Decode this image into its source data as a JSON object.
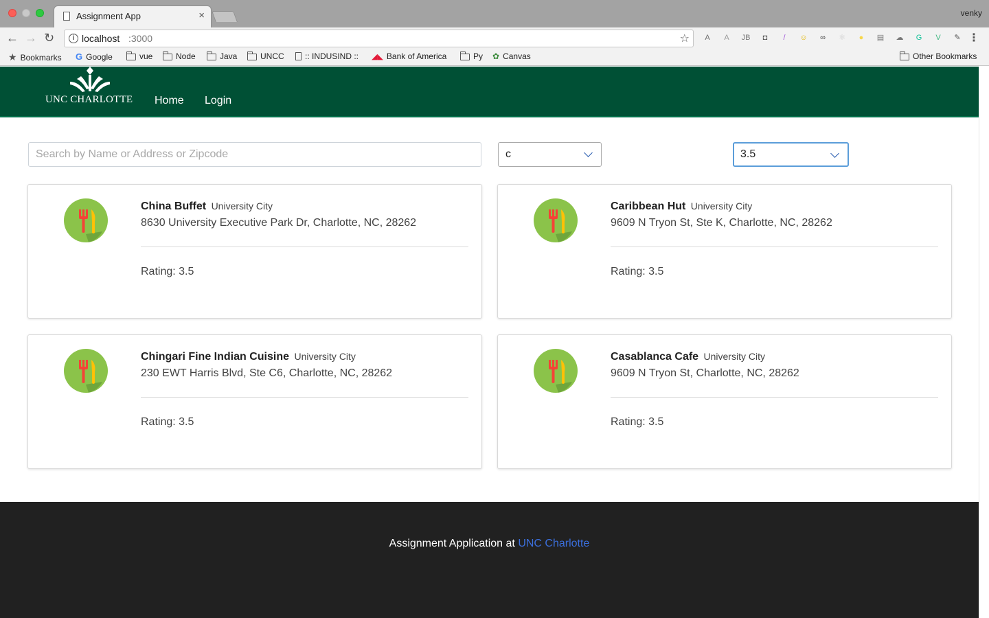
{
  "browser": {
    "tab_title": "Assignment App",
    "tab_close": "×",
    "profile": "venky",
    "url_host": "localhost",
    "url_port": ":3000",
    "nav": {
      "back": "←",
      "forward": "→",
      "reload": "↻"
    },
    "star": "☆",
    "menu": "⋮",
    "extensions": [
      {
        "icon": "shield-ext-icon",
        "glyph": "A",
        "color": "#6b6b6b"
      },
      {
        "icon": "angular-ext-icon",
        "glyph": "A",
        "color": "#9a9a9a"
      },
      {
        "icon": "jb-ext-icon",
        "glyph": "JB",
        "color": "#7a7a7a"
      },
      {
        "icon": "lock-ext-icon",
        "glyph": "◘",
        "color": "#555555"
      },
      {
        "icon": "feather-ext-icon",
        "glyph": "/",
        "color": "#a259d9"
      },
      {
        "icon": "people-ext-icon",
        "glyph": "☺",
        "color": "#e2b500"
      },
      {
        "icon": "mask-ext-icon",
        "glyph": "∞",
        "color": "#444444"
      },
      {
        "icon": "react-ext-icon",
        "glyph": "⚛",
        "color": "#c9c9c9"
      },
      {
        "icon": "sun-ext-icon",
        "glyph": "●",
        "color": "#f7d64a"
      },
      {
        "icon": "window-ext-icon",
        "glyph": "▤",
        "color": "#777777"
      },
      {
        "icon": "cloud-ext-icon",
        "glyph": "☁",
        "color": "#777777"
      },
      {
        "icon": "grammarly-ext-icon",
        "glyph": "G",
        "color": "#15c39a"
      },
      {
        "icon": "vue-ext-icon",
        "glyph": "V",
        "color": "#41b883"
      },
      {
        "icon": "wand-ext-icon",
        "glyph": "✎",
        "color": "#555555"
      }
    ]
  },
  "bookmarks": [
    {
      "label": "Bookmarks",
      "icon": "star-icon"
    },
    {
      "label": "Google",
      "icon": "google-icon"
    },
    {
      "label": "vue",
      "icon": "folder-icon"
    },
    {
      "label": "Node",
      "icon": "folder-icon"
    },
    {
      "label": "Java",
      "icon": "folder-icon"
    },
    {
      "label": "UNCC",
      "icon": "folder-icon"
    },
    {
      "label": ":: INDUSIND ::",
      "icon": "page-icon"
    },
    {
      "label": "Bank of America",
      "icon": "boa-icon"
    },
    {
      "label": "Py",
      "icon": "folder-icon"
    },
    {
      "label": "Canvas",
      "icon": "canvas-icon"
    }
  ],
  "other_bookmarks": "Other Bookmarks",
  "site": {
    "logo_text": "UNC CHARLOTTE",
    "nav": {
      "home": "Home",
      "login": "Login"
    },
    "colors": {
      "nav_bg": "#005035",
      "footer_bg": "#212121",
      "link": "#3b6fdd",
      "icon_green": "#8bc34a"
    }
  },
  "filters": {
    "search_placeholder": "Search by Name or Address or Zipcode",
    "search_value": "",
    "category_selected": "c",
    "rating_selected": "3.5"
  },
  "restaurants": [
    {
      "name": "China Buffet",
      "area": "University City",
      "address": "8630 University Executive Park Dr, Charlotte, NC, 28262",
      "rating": "Rating: 3.5"
    },
    {
      "name": "Caribbean Hut",
      "area": "University City",
      "address": "9609 N Tryon St, Ste K, Charlotte, NC, 28262",
      "rating": "Rating: 3.5"
    },
    {
      "name": "Chingari Fine Indian Cuisine",
      "area": "University City",
      "address": "230 EWT Harris Blvd, Ste C6, Charlotte, NC, 28262",
      "rating": "Rating: 3.5"
    },
    {
      "name": "Casablanca Cafe",
      "area": "University City",
      "address": "9609 N Tryon St, Charlotte, NC, 28262",
      "rating": "Rating: 3.5"
    }
  ],
  "footer": {
    "text": "Assignment Application at ",
    "link": "UNC Charlotte"
  }
}
